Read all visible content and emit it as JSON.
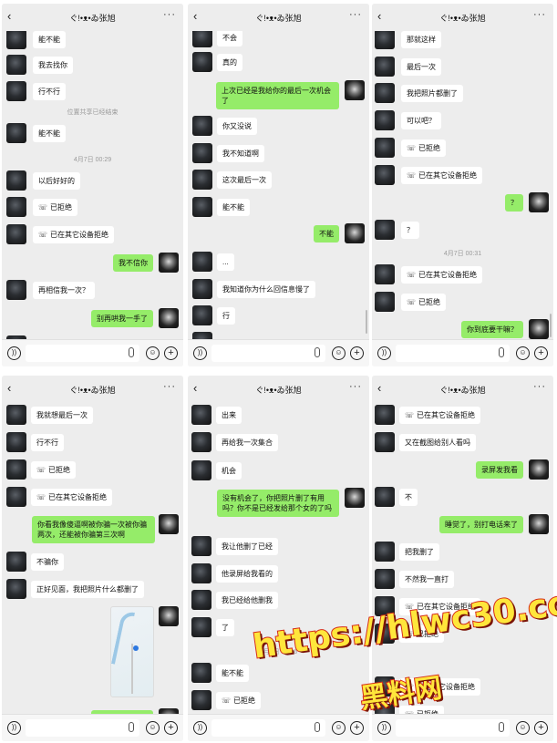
{
  "contact_name": "ぐ!•ᴥ•ゐ张旭",
  "time_label": "4月7日 00:36",
  "panels": [
    {
      "id": "p1",
      "messages": [
        {
          "side": "left",
          "text": "能不能"
        },
        {
          "side": "left",
          "text": "我去找你"
        },
        {
          "side": "left",
          "text": "行不行"
        },
        {
          "side": "time",
          "text": "位置共享已经结束"
        },
        {
          "side": "left",
          "text": "能不能"
        },
        {
          "side": "time",
          "text": "4月7日 00:29"
        },
        {
          "side": "left",
          "text": "以后好好的"
        },
        {
          "side": "left",
          "text": "已拒绝",
          "call": true
        },
        {
          "side": "left",
          "text": "已在其它设备拒绝",
          "call": true
        },
        {
          "side": "right",
          "text": "我不信你"
        },
        {
          "side": "left",
          "text": "再相信我一次？"
        },
        {
          "side": "right",
          "text": "别再哄我一手了"
        }
      ]
    },
    {
      "id": "p2",
      "messages": [
        {
          "side": "left",
          "text": "不会"
        },
        {
          "side": "left",
          "text": "真的"
        },
        {
          "side": "right",
          "text": "上次已经是我给你的最后一次机会了",
          "multi": true
        },
        {
          "side": "left",
          "text": "你又没说"
        },
        {
          "side": "left",
          "text": "我不知道啊"
        },
        {
          "side": "left",
          "text": "这次最后一次"
        },
        {
          "side": "left",
          "text": "能不能"
        },
        {
          "side": "right",
          "text": "不能"
        },
        {
          "side": "left",
          "text": "..."
        },
        {
          "side": "left",
          "text": "我知道你为什么回信息慢了"
        },
        {
          "side": "left",
          "text": "行"
        }
      ]
    },
    {
      "id": "p3",
      "messages": [
        {
          "side": "left",
          "text": "那就这样"
        },
        {
          "side": "left",
          "text": "最后一次"
        },
        {
          "side": "left",
          "text": "我把照片都删了"
        },
        {
          "side": "left",
          "text": "可以吧？"
        },
        {
          "side": "left",
          "text": "已拒绝",
          "call": true
        },
        {
          "side": "left",
          "text": "已在其它设备拒绝",
          "call": true
        },
        {
          "side": "right",
          "text": "？"
        },
        {
          "side": "left",
          "text": "？"
        },
        {
          "side": "time",
          "text": "4月7日 00:31"
        },
        {
          "side": "left",
          "text": "已在其它设备拒绝",
          "call": true
        },
        {
          "side": "left",
          "text": "已拒绝",
          "call": true
        },
        {
          "side": "right",
          "text": "你到底要干嘛？"
        }
      ]
    },
    {
      "id": "p4",
      "messages": [
        {
          "side": "left",
          "text": "我就想最后一次"
        },
        {
          "side": "left",
          "text": "行不行"
        },
        {
          "side": "left",
          "text": "已拒绝",
          "call": true
        },
        {
          "side": "left",
          "text": "已在其它设备拒绝",
          "call": true
        },
        {
          "side": "right",
          "text": "你看我像傻逼啊被你骗一次被你骗两次，还能被你骗第三次啊",
          "multi": true
        },
        {
          "side": "left",
          "text": "不骗你"
        },
        {
          "side": "left",
          "text": "正好见面，我把照片什么都删了"
        },
        {
          "side": "right",
          "text": "今天已经到家了"
        }
      ]
    },
    {
      "id": "p5",
      "messages": [
        {
          "side": "left",
          "text": "出来"
        },
        {
          "side": "left",
          "text": "再给我一次集合"
        },
        {
          "side": "left",
          "text": "机会"
        },
        {
          "side": "right",
          "text": "没有机会了，你把照片删了有用吗？你不是已经发给那个女的了吗",
          "multi": true
        },
        {
          "side": "left",
          "text": "我让他删了已经"
        },
        {
          "side": "left",
          "text": "他录屏给我看的"
        },
        {
          "side": "left",
          "text": "我已经给他删我"
        },
        {
          "side": "left",
          "text": "了"
        },
        {
          "side": "time",
          "text": "4月7日 00:36"
        },
        {
          "side": "left",
          "text": "能不能"
        },
        {
          "side": "left",
          "text": "已拒绝",
          "call": true
        }
      ]
    },
    {
      "id": "p6",
      "messages": [
        {
          "side": "left",
          "text": "已在其它设备拒绝",
          "call": true
        },
        {
          "side": "left",
          "text": "又在截图给别人看吗"
        },
        {
          "side": "right",
          "text": "录屏发我看"
        },
        {
          "side": "left",
          "text": "不"
        },
        {
          "side": "right",
          "text": "睡觉了，别打电话来了"
        },
        {
          "side": "left",
          "text": "把我删了"
        },
        {
          "side": "left",
          "text": "不然我一直打"
        },
        {
          "side": "left",
          "text": "已在其它设备拒绝",
          "call": true
        },
        {
          "side": "left",
          "text": "已拒绝",
          "call": true
        },
        {
          "side": "left",
          "text": "已在其它设备拒绝",
          "call": true
        },
        {
          "side": "left",
          "text": "已拒绝",
          "call": true
        }
      ]
    }
  ],
  "watermark": {
    "url": "https://hlwc30.com",
    "name": "黑料网"
  },
  "icons": {
    "back": "chevron-left-icon",
    "more": "more-icon",
    "voice": "voice-icon",
    "emoji": "emoji-icon",
    "plus": "plus-icon",
    "call": "phone-icon"
  },
  "colors": {
    "panel_bg": "#ededed",
    "my_bubble": "#95ec69",
    "their_bubble": "#ffffff",
    "watermark_fill": "#ffe63b",
    "watermark_stroke": "#d62a18"
  }
}
